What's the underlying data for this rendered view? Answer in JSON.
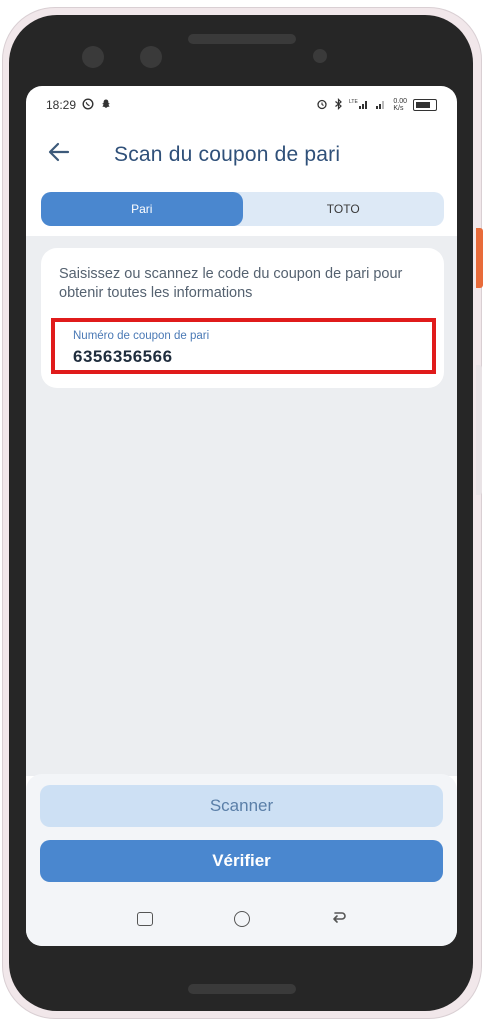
{
  "status_bar": {
    "time": "18:29",
    "left_icons": [
      "whatsapp-icon",
      "snapchat-icon"
    ],
    "right_icons": [
      "alarm-icon",
      "bluetooth-icon",
      "lte-signal-icon",
      "signal-icon",
      "battery-icon"
    ],
    "lte_label": "LTE",
    "data_speed": "0.00\nK/s"
  },
  "header": {
    "title": "Scan du coupon de pari",
    "back_icon": "arrow-left-icon"
  },
  "tabs": [
    {
      "label": "Pari",
      "active": true
    },
    {
      "label": "TOTO",
      "active": false
    }
  ],
  "card": {
    "description": "Saisissez ou scannez le code du coupon de pari pour obtenir toutes les informations",
    "field": {
      "label": "Numéro de coupon de pari",
      "value": "6356356566"
    }
  },
  "actions": {
    "scan_label": "Scanner",
    "verify_label": "Vérifier"
  },
  "nav": {
    "recent_icon": "square-icon",
    "home_icon": "circle-icon",
    "back_icon": "back-arrow-icon"
  },
  "colors": {
    "accent": "#4a87cf",
    "highlight_border": "#e01b1b",
    "title": "#2f5079"
  }
}
